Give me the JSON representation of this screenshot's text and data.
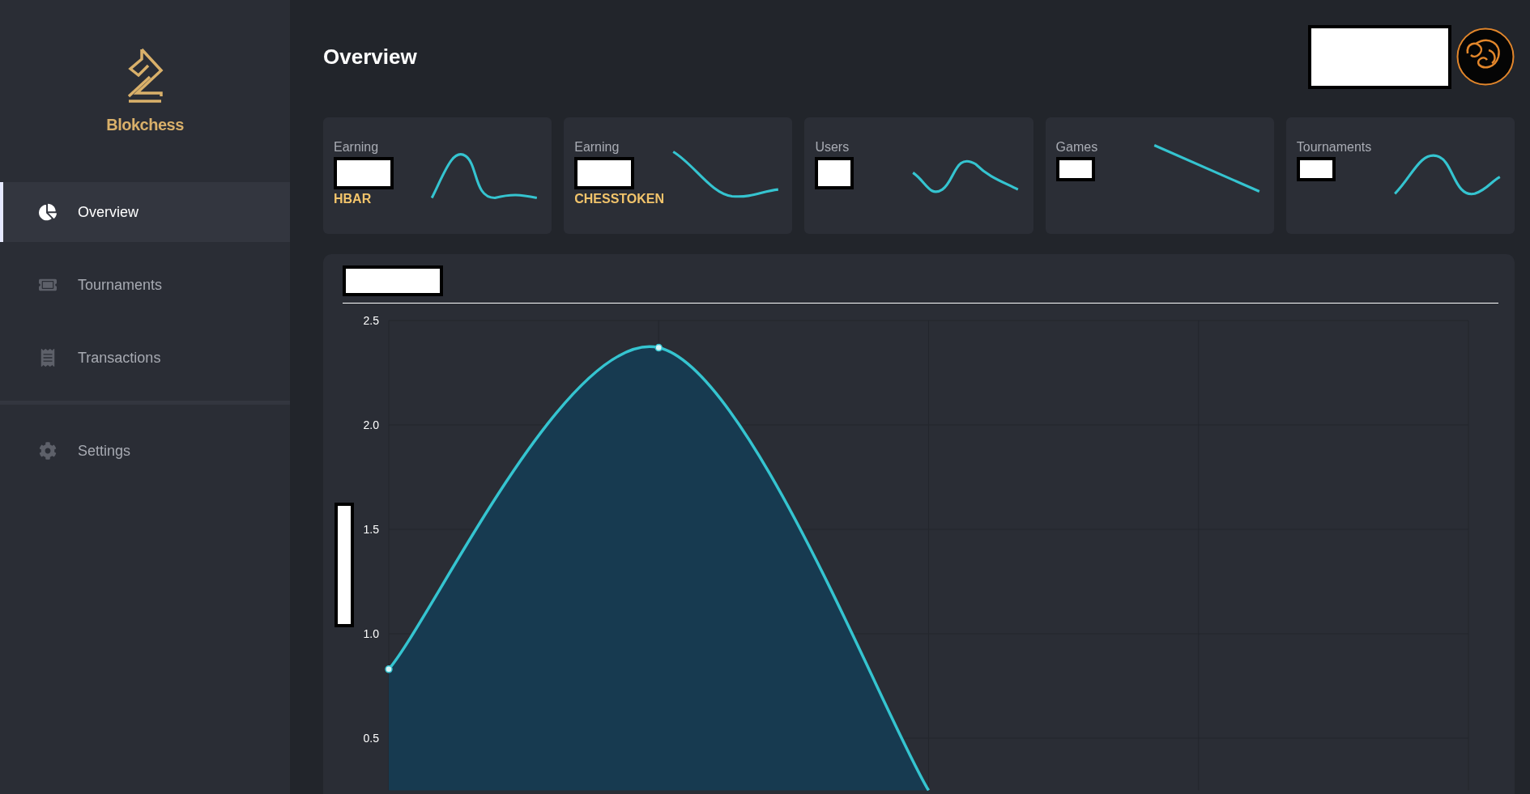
{
  "sidebar": {
    "brand": "Blokchess",
    "nav_items": [
      {
        "label": "Overview",
        "selected": true
      },
      {
        "label": "Tournaments",
        "selected": false
      },
      {
        "label": "Transactions",
        "selected": false
      }
    ],
    "settings_items": [
      {
        "label": "Settings",
        "selected": false
      }
    ]
  },
  "header": {
    "title": "Overview"
  },
  "stat_cards": [
    {
      "title": "Earning",
      "unit": "HBAR"
    },
    {
      "title": "Earning",
      "unit": "CHESSTOKEN"
    },
    {
      "title": "Users"
    },
    {
      "title": "Games"
    },
    {
      "title": "Tournaments"
    }
  ],
  "chart_panel": {
    "chart_data": {
      "type": "area",
      "categories": [
        null,
        null,
        null,
        null,
        null
      ],
      "series": [
        {
          "color": "#35c4d0",
          "values": [
            0.83,
            2.37,
            0.25,
            null,
            null
          ]
        }
      ],
      "grid": true,
      "ylim": [
        0.25,
        2.5
      ],
      "yticks": [
        {
          "value": 0.5,
          "label": "0.5"
        },
        {
          "value": 1,
          "label": "1.0"
        },
        {
          "value": 1.5,
          "label": "1.5"
        },
        {
          "value": 2,
          "label": "2.0"
        },
        {
          "value": 2.5,
          "label": "2.5"
        }
      ]
    }
  }
}
